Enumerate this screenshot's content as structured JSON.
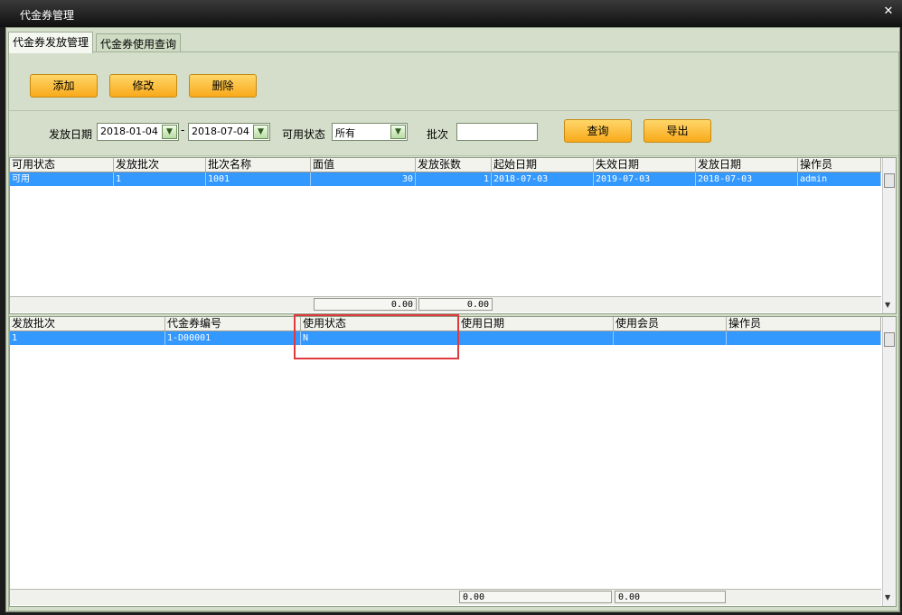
{
  "window": {
    "title": "代金券管理",
    "close_glyph": "✕"
  },
  "tabs": [
    {
      "label": "代金券发放管理",
      "active": true
    },
    {
      "label": "代金券使用查询",
      "active": false
    }
  ],
  "toolbar": {
    "add_label": "添加",
    "edit_label": "修改",
    "delete_label": "删除"
  },
  "filters": {
    "issue_date_label": "发放日期",
    "date_from": "2018-01-04",
    "date_sep": "-",
    "date_to": "2018-07-04",
    "status_label": "可用状态",
    "status_value": "所有",
    "batch_label": "批次",
    "batch_value": "",
    "query_label": "查询",
    "export_label": "导出"
  },
  "top_grid": {
    "columns": [
      "可用状态",
      "发放批次",
      "批次名称",
      "面值",
      "发放张数",
      "起始日期",
      "失效日期",
      "发放日期",
      "操作员"
    ],
    "rows": [
      [
        "可用",
        "1",
        "1001",
        "30",
        "1",
        "2018-07-03",
        "2019-07-03",
        "2018-07-03",
        "admin"
      ]
    ],
    "totals": {
      "face_value": "0.00",
      "count": "0.00"
    }
  },
  "bottom_grid": {
    "columns": [
      "发放批次",
      "代金券编号",
      "使用状态",
      "使用日期",
      "使用会员",
      "操作员"
    ],
    "rows": [
      [
        "1",
        "1-D00001",
        "N",
        "",
        "",
        ""
      ]
    ],
    "totals": {
      "t1": "0.00",
      "t2": "0.00"
    }
  },
  "colors": {
    "accent_orange": "#f8a91a",
    "selection_blue": "#3399ff",
    "panel_green": "#d4deca",
    "highlight_red": "#e0393e"
  }
}
